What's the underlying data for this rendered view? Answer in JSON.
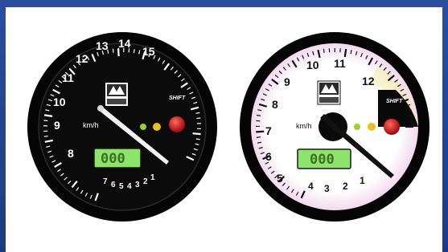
{
  "gauges": [
    {
      "id": "black",
      "brand": "SHIFT",
      "unit": "km/h",
      "numerals": [
        "8",
        "9",
        "10",
        "11",
        "12",
        "13",
        "14",
        "15"
      ],
      "small_numerals": [
        "7",
        "6",
        "5",
        "4",
        "3",
        "2",
        "1"
      ],
      "display": "000",
      "colors": {
        "face": "#0a0a0a",
        "marks": "#ffffff",
        "lcd": "#8ee36a"
      }
    },
    {
      "id": "white",
      "brand": "SHIFT",
      "unit": "km/h",
      "numerals": [
        "5",
        "6",
        "7",
        "8",
        "9",
        "10",
        "11",
        "12"
      ],
      "small_numerals": [
        "4",
        "3",
        "2",
        "1"
      ],
      "display": "000",
      "colors": {
        "face": "#ffffff",
        "marks": "#111111",
        "lcd": "#8ee36a"
      }
    }
  ],
  "indicators": {
    "colors": {
      "green": "#9ad12b",
      "yellow": "#e8c21a",
      "red": "#c8101a"
    }
  }
}
